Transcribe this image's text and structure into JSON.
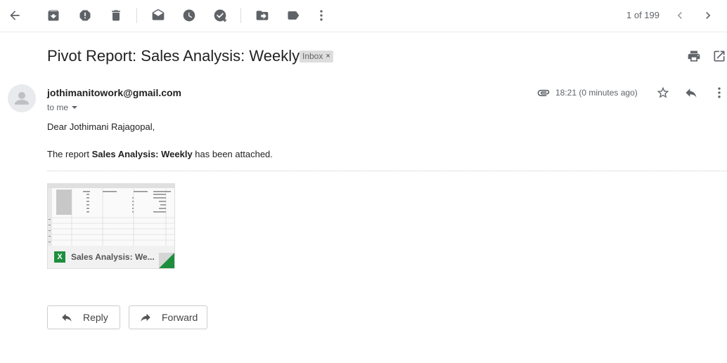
{
  "toolbar": {
    "icons": [
      "back-arrow-icon",
      "archive-icon",
      "report-spam-icon",
      "delete-icon",
      "mark-unread-icon",
      "snooze-icon",
      "add-to-tasks-icon",
      "move-to-icon",
      "labels-icon",
      "more-vert-icon"
    ],
    "pager": "1 of 199"
  },
  "email": {
    "subject": "Pivot Report: Sales Analysis: Weekly",
    "label": "Inbox",
    "label_close": "×",
    "sender": "jothimanitowork@gmail.com",
    "to": "to me",
    "time": "18:21 (0 minutes ago)",
    "greeting": "Dear Jothimani Rajagopal,",
    "body_pre": "The report ",
    "body_bold": "Sales Analysis: Weekly",
    "body_post": " has been attached."
  },
  "attachment": {
    "type_badge": "X",
    "name": "Sales Analysis: We..."
  },
  "actions": {
    "reply": "Reply",
    "forward": "Forward"
  },
  "colors": {
    "excel_green": "#1e8e3e",
    "icon_grey": "#5f6368"
  }
}
